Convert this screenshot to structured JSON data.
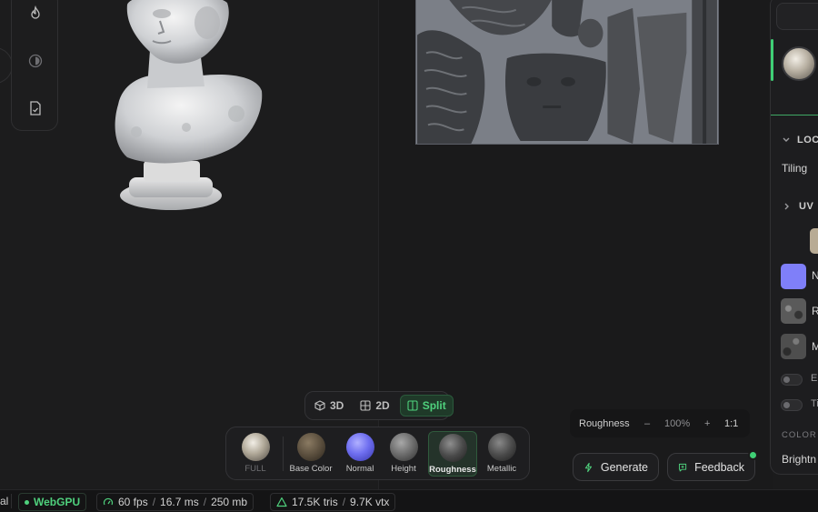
{
  "toolbar_left": {
    "tools": [
      {
        "icon": "flame-icon"
      },
      {
        "icon": "contrast-icon"
      },
      {
        "icon": "export-file-icon"
      }
    ]
  },
  "right_panel": {
    "section_local": "LOC",
    "tiling_label": "Tiling",
    "section_uv": "UV",
    "map_rows": [
      {
        "label": "N",
        "color": "#7f7ff9"
      },
      {
        "label": "R",
        "color": "#5a5a5a"
      },
      {
        "label": "M",
        "color": "#4e4e4e"
      }
    ],
    "toggle_rows": [
      {
        "label": "E"
      },
      {
        "label": "Ti"
      }
    ],
    "section_color": "COLOR",
    "brightness_label": "Brightn"
  },
  "view_modes": {
    "options": [
      {
        "label": "3D",
        "icon": "cube-icon",
        "active": false
      },
      {
        "label": "2D",
        "icon": "grid-icon",
        "active": false
      },
      {
        "label": "Split",
        "icon": "split-view-icon",
        "active": true
      }
    ]
  },
  "channels": {
    "items": [
      {
        "label": "FULL",
        "active": false
      },
      {
        "label": "Base Color",
        "active": false
      },
      {
        "label": "Normal",
        "active": false
      },
      {
        "label": "Height",
        "active": false
      },
      {
        "label": "Roughness",
        "active": true
      },
      {
        "label": "Metallic",
        "active": false
      }
    ]
  },
  "zoom_bar": {
    "channel": "Roughness",
    "minus": "–",
    "zoom": "100%",
    "plus": "+",
    "ratio": "1:1"
  },
  "actions": {
    "generate": "Generate",
    "feedback": "Feedback"
  },
  "status_bar": {
    "left_fragment": "al",
    "renderer": "WebGPU",
    "fps": "60 fps",
    "frame_ms": "16.7 ms",
    "memory": "250 mb",
    "tris": "17.5K tris",
    "vtx": "9.7K vtx",
    "separator": "/"
  },
  "colors": {
    "accent": "#3fcf75",
    "normal_swatch": "#7f7ff9"
  }
}
